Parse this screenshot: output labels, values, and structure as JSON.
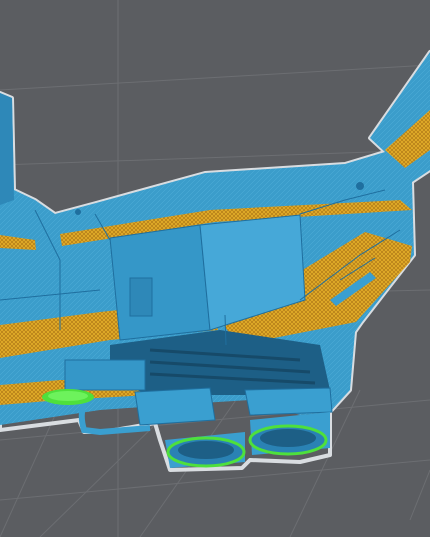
{
  "viewport": {
    "name": "3d-model-viewport",
    "background_color": "#5b5d61",
    "grid_color": "#6c6e72",
    "model_primary_color": "#3a9fd0",
    "model_shadow_color": "#1f6f9f",
    "overhang_highlight_color": "#d8a21c",
    "selection_highlight_color": "#4ee03c",
    "outline_color": "#d9dde1"
  }
}
